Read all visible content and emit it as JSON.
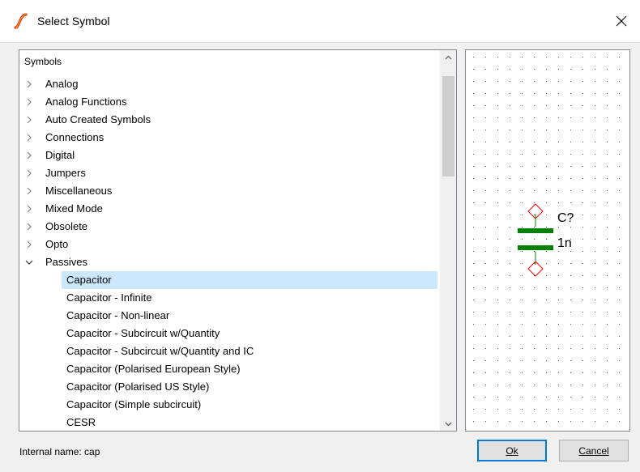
{
  "window": {
    "title": "Select Symbol",
    "close_glyph": "✕"
  },
  "tree": {
    "header": "Symbols",
    "categories": [
      {
        "label": "Analog",
        "expanded": false
      },
      {
        "label": "Analog Functions",
        "expanded": false
      },
      {
        "label": "Auto Created Symbols",
        "expanded": false
      },
      {
        "label": "Connections",
        "expanded": false
      },
      {
        "label": "Digital",
        "expanded": false
      },
      {
        "label": "Jumpers",
        "expanded": false
      },
      {
        "label": "Miscellaneous",
        "expanded": false
      },
      {
        "label": "Mixed Mode",
        "expanded": false
      },
      {
        "label": "Obsolete",
        "expanded": false
      },
      {
        "label": "Opto",
        "expanded": false
      },
      {
        "label": "Passives",
        "expanded": true
      }
    ],
    "passives_children": [
      {
        "label": "Capacitor",
        "selected": true
      },
      {
        "label": "Capacitor - Infinite",
        "selected": false
      },
      {
        "label": "Capacitor - Non-linear",
        "selected": false
      },
      {
        "label": "Capacitor - Subcircuit w/Quantity",
        "selected": false
      },
      {
        "label": "Capacitor - Subcircuit w/Quantity and IC",
        "selected": false
      },
      {
        "label": "Capacitor (Polarised European Style)",
        "selected": false
      },
      {
        "label": "Capacitor (Polarised US Style)",
        "selected": false
      },
      {
        "label": "Capacitor (Simple subcircuit)",
        "selected": false
      },
      {
        "label": "CESR",
        "selected": false
      }
    ]
  },
  "preview": {
    "ref_label": "C?",
    "value_label": "1n",
    "plate_color": "#008000",
    "pin_color": "#ff0000",
    "dot_color": "#555555"
  },
  "status": {
    "internal_name": "Internal name: cap"
  },
  "buttons": {
    "ok": "Ok",
    "cancel": "Cancel"
  }
}
